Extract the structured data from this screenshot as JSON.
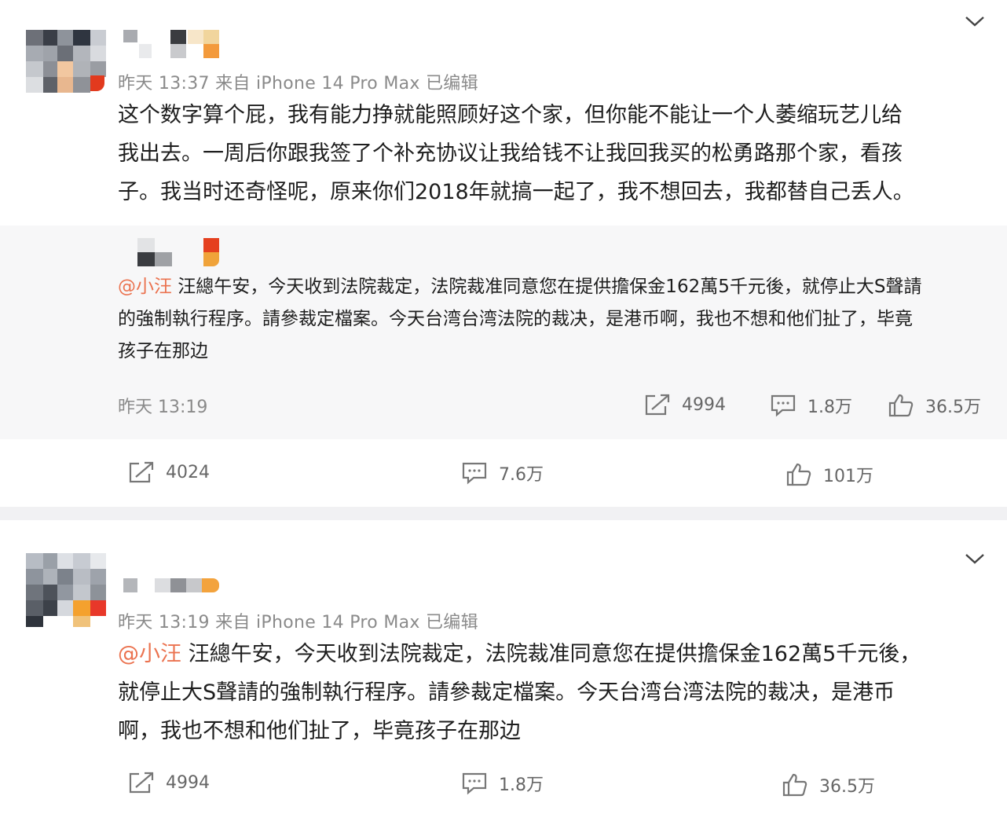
{
  "posts": [
    {
      "time": "昨天 13:37 来自 iPhone 14 Pro Max 已编辑",
      "text_lines": [
        "这个数字算个屁，我有能力挣就能照顾好这个家，但你能不能让一个人萎缩玩艺儿给",
        "我出去。一周后你跟我签了个补充协议让我给钱不让我回我买的松勇路那个家，看孩",
        "子。我当时还奇怪呢，原来你们2018年就搞一起了，我不想回去，我都替自己丢人。"
      ],
      "repost": {
        "mention": "@小汪",
        "text_line1": " 汪總午安，今天收到法院裁定，法院裁准同意您在提供擔保金162萬5千元後，就停止大S聲請",
        "text_line2": "的強制執行程序。請參裁定檔案。今天台湾台湾法院的裁决，是港币啊，我也不想和他们扯了，毕竟",
        "text_line3": "孩子在那边",
        "time": "昨天 13:19",
        "shares": "4994",
        "comments": "1.8万",
        "likes": "36.5万"
      },
      "shares": "4024",
      "comments": "7.6万",
      "likes": "101万"
    },
    {
      "time": "昨天 13:19 来自 iPhone 14 Pro Max 已编辑",
      "mention": "@小汪",
      "text_line1": " 汪總午安，今天收到法院裁定，法院裁准同意您在提供擔保金162萬5千元後，",
      "text_line2": "就停止大S聲請的強制執行程序。請參裁定檔案。今天台湾台湾法院的裁决，是港币",
      "text_line3": "啊，我也不想和他们扯了，毕竟孩子在那边",
      "shares": "4994",
      "comments": "1.8万",
      "likes": "36.5万"
    }
  ],
  "icons": {
    "share": "share-icon",
    "comment": "comment-icon",
    "like": "thumbs-up-icon",
    "menu": "chevron-down-icon"
  },
  "colors": {
    "mention": "#eb7350",
    "meta": "#8a8a8a",
    "repost_bg": "#f7f7f8",
    "divider": "#f1f1f3"
  }
}
